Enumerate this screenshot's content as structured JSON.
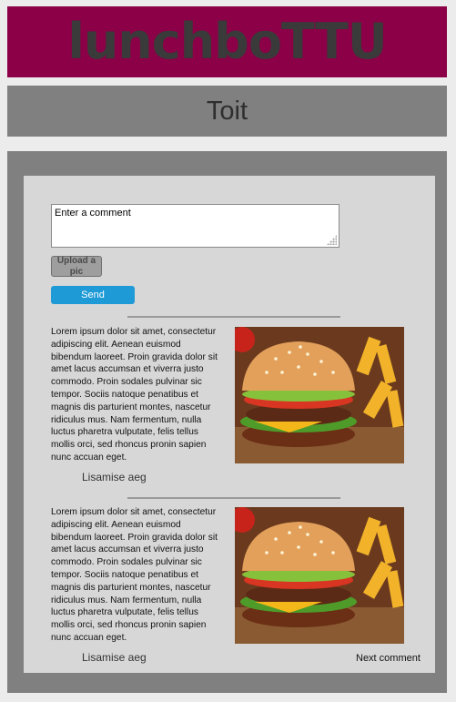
{
  "header": {
    "logo_text": "lunchboTTU"
  },
  "section": {
    "title": "Toit"
  },
  "composer": {
    "comment_placeholder": "Enter a comment",
    "upload_label": "Upload a pic",
    "send_label": "Send"
  },
  "posts": [
    {
      "text": "Lorem ipsum dolor sit amet, consectetur adipiscing elit. Aenean euismod bibendum laoreet. Proin gravida dolor sit amet lacus accumsan et viverra justo commodo. Proin sodales pulvinar sic tempor. Sociis natoque penatibus et magnis dis parturient montes, nascetur ridiculus mus. Nam fermentum, nulla luctus pharetra vulputate, felis tellus mollis orci, sed rhoncus pronin sapien nunc accuan eget.",
      "label": "Lisamise aeg",
      "image_icon": "burger-image"
    },
    {
      "text": "Lorem ipsum dolor sit amet, consectetur adipiscing elit. Aenean euismod bibendum laoreet. Proin gravida dolor sit amet lacus accumsan et viverra justo commodo. Proin sodales pulvinar sic tempor. Sociis natoque penatibus et magnis dis parturient montes, nascetur ridiculus mus. Nam fermentum, nulla luctus pharetra vulputate, felis tellus mollis orci, sed rhoncus pronin sapien nunc accuan eget.",
      "label": "Lisamise aeg",
      "image_icon": "burger-image"
    }
  ],
  "footer": {
    "next_label": "Next comment"
  },
  "colors": {
    "brand": "#8b0046",
    "bar": "#808080",
    "panel": "#d7d7d7",
    "send": "#1e9ad6"
  }
}
